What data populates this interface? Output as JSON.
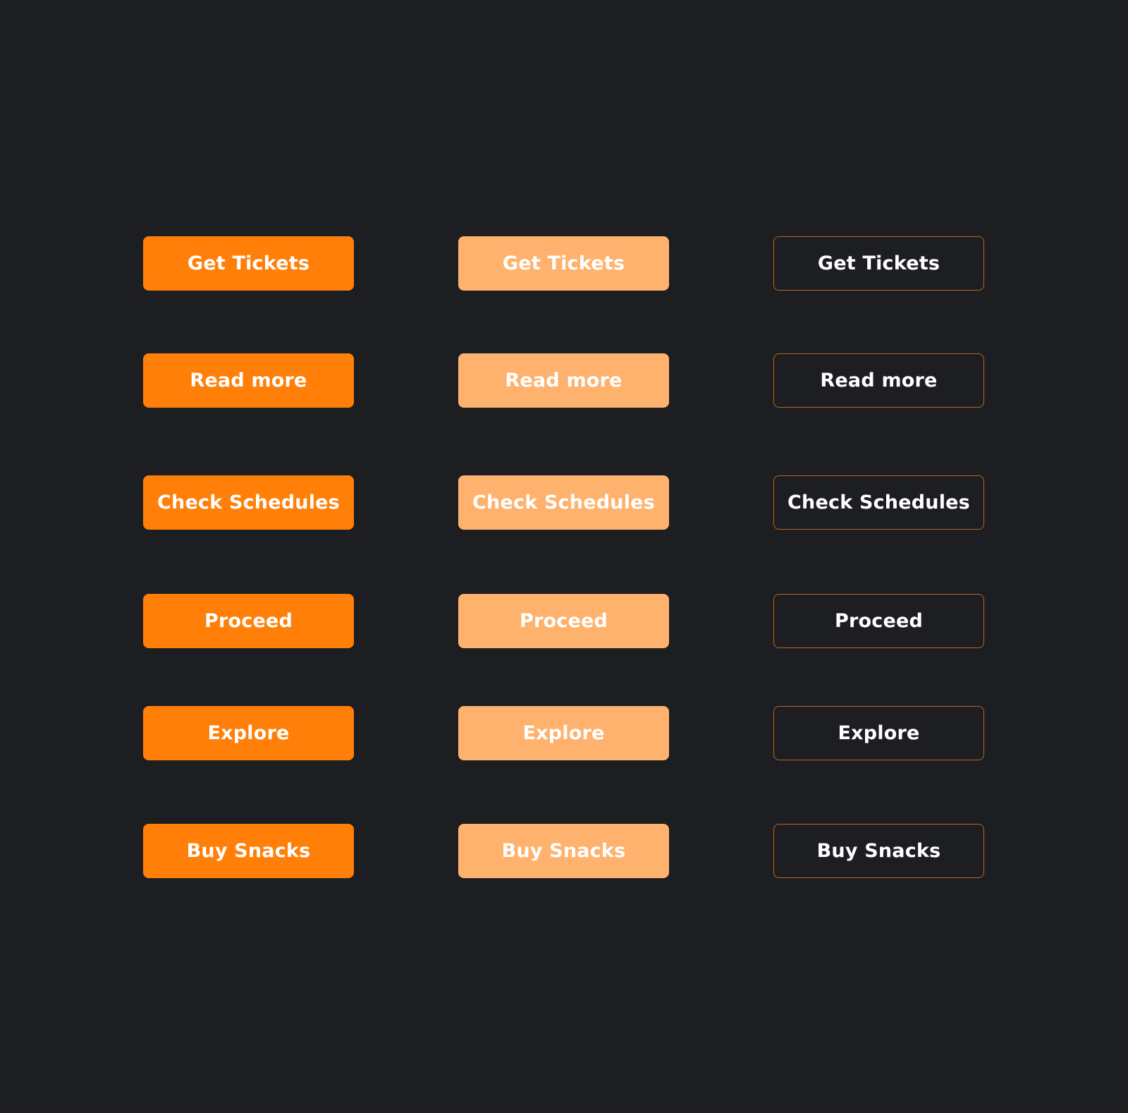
{
  "colors": {
    "background": "#1c1e22",
    "primary": "#ff7f08",
    "light": "#feb26d",
    "outline_border": "#b8661f",
    "text": "#ffffff"
  },
  "columns": [
    {
      "variant": "primary",
      "buttons": [
        "Get Tickets",
        "Read more",
        "Check Schedules",
        "Proceed",
        "Explore",
        "Buy Snacks"
      ]
    },
    {
      "variant": "light",
      "buttons": [
        "Get Tickets",
        "Read more",
        "Check Schedules",
        "Proceed",
        "Explore",
        "Buy Snacks"
      ]
    },
    {
      "variant": "outline",
      "buttons": [
        "Get Tickets",
        "Read more",
        "Check Schedules",
        "Proceed",
        "Explore",
        "Buy Snacks"
      ]
    }
  ]
}
